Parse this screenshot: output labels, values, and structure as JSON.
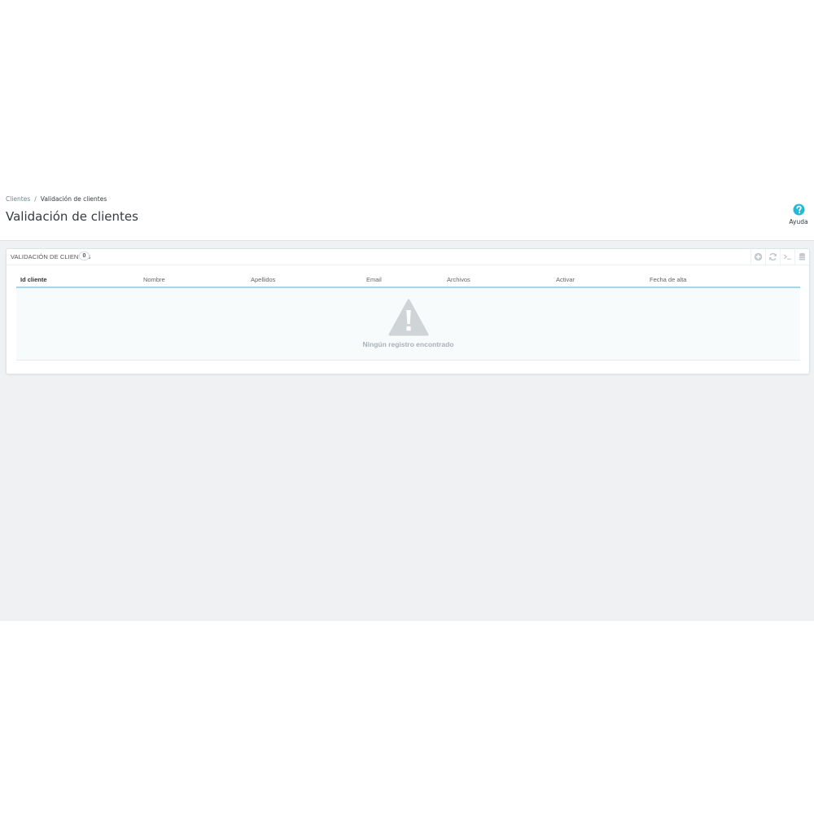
{
  "breadcrumb": {
    "parent": "Clientes",
    "separator": "/",
    "current": "Validación de clientes"
  },
  "page": {
    "title": "Validación de clientes"
  },
  "toolbar": {
    "help_icon": "question-circle-icon",
    "help_label": "Ayuda"
  },
  "panel": {
    "title": "VALIDACIÓN DE CLIENTES",
    "count": "0",
    "tools": [
      "plus-circle-icon",
      "refresh-icon",
      "terminal-icon",
      "database-icon"
    ]
  },
  "table": {
    "columns": [
      "Id cliente",
      "Nombre",
      "Apellidos",
      "Email",
      "Archivos",
      "Activar",
      "Fecha de alta"
    ],
    "empty_icon": "warning-triangle-icon",
    "empty_message": "Ningún registro encontrado"
  },
  "colors": {
    "accent": "#25b9d7",
    "background": "#eff1f2",
    "header_underline": "#a8d4e3",
    "empty_icon": "#cfd4d6"
  }
}
